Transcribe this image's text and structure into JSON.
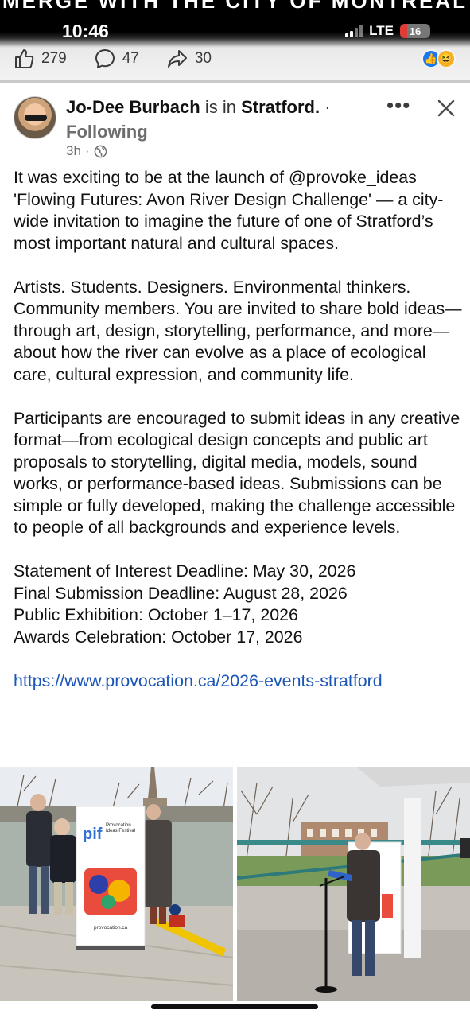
{
  "status_bar": {
    "time": "10:46",
    "network": "LTE",
    "battery": "16"
  },
  "background_banner_text": "MERGE WITH THE CITY OF MONTREAL",
  "reactions_bar": {
    "likes": "279",
    "comments": "47",
    "shares": "30",
    "reaction_icons": [
      "like-icon",
      "haha-icon"
    ]
  },
  "post": {
    "author": "Jo-Dee Burbach",
    "is_in": "is in",
    "location": "Stratford.",
    "separator": "·",
    "following": "Following",
    "time": "3h",
    "dot": "·",
    "paragraphs": [
      "It was exciting to be at the launch of @provoke_ideas 'Flowing Futures: Avon River Design Challenge' — a city-wide invitation to imagine the future of one of Stratford’s most important natural and cultural spaces.",
      "Artists. Students. Designers. Environmental thinkers. Community members. You are invited to share bold ideas—through art, design, storytelling, performance, and more—about how the river can evolve as a place of ecological care, cultural expression, and community life.",
      "Participants are encouraged to submit ideas in any creative format—from ecological design concepts and public art proposals to storytelling, digital media, models, sound works, or performance-based ideas. Submissions can be simple or fully developed, making the challenge accessible to people of all backgrounds and experience levels."
    ],
    "deadlines": [
      "Statement of Interest Deadline: May 30, 2026",
      "Final Submission Deadline: August 28, 2026",
      "Public Exhibition: October 1–17, 2026",
      "Awards Celebration: October 17, 2026"
    ],
    "link": "https://www.provocation.ca/2026-events-stratford"
  },
  "photos": {
    "banner_logo": "pif",
    "banner_title": "Provocation Ideas Festival",
    "banner_url": "provocation.ca"
  },
  "colors": {
    "link": "#1a55b8",
    "like_blue": "#1877f2",
    "battery_red": "#e23b35"
  }
}
